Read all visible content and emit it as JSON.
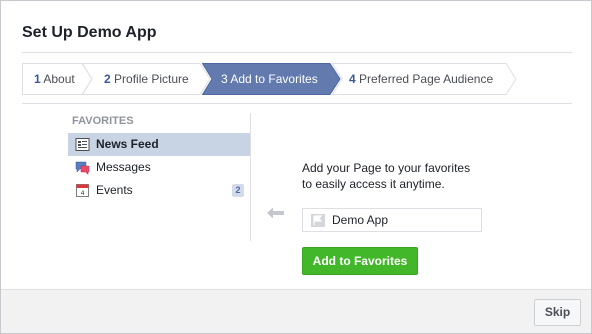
{
  "dialog": {
    "title": "Set Up Demo App"
  },
  "steps": [
    {
      "num": "1",
      "label": "About",
      "active": false
    },
    {
      "num": "2",
      "label": "Profile Picture",
      "active": false
    },
    {
      "num": "3",
      "label": "Add to Favorites",
      "active": true
    },
    {
      "num": "4",
      "label": "Preferred Page Audience",
      "active": false
    }
  ],
  "favorites": {
    "header": "FAVORITES",
    "items": [
      {
        "label": "News Feed",
        "icon": "news-feed-icon",
        "selected": true
      },
      {
        "label": "Messages",
        "icon": "messages-icon",
        "selected": false
      },
      {
        "label": "Events",
        "icon": "events-icon",
        "selected": false,
        "badge": "2"
      }
    ]
  },
  "content": {
    "description_line1": "Add your Page to your favorites",
    "description_line2": "to easily access it anytime.",
    "app_name": "Demo App",
    "add_button_label": "Add to Favorites"
  },
  "footer": {
    "skip_label": "Skip"
  },
  "colors": {
    "active_step": "#627aad",
    "add_button": "#42b72a",
    "selected_item": "#c8d3e3"
  }
}
